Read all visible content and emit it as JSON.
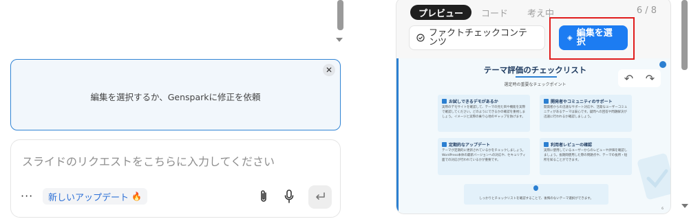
{
  "chat": {
    "edit_hint": "編集を選択するか、Gensparkに修正を依頼",
    "input_placeholder": "スライドのリクエストをこちらに入力してください",
    "more_label": "···",
    "update_chip": "新しいアップデート",
    "close_glyph": "✕"
  },
  "preview": {
    "tabs": [
      "プレビュー",
      "コード",
      "考え中"
    ],
    "page_count": "6 / 8",
    "fact_check_label": "ファクトチェックコンテンツ",
    "select_edit_label": "編集を選択",
    "colors": {
      "accent": "#1c7cf2",
      "highlight_frame": "#e01b1b",
      "slide_accent": "#2b7fd1"
    }
  },
  "slide": {
    "title": "テーマ評価のチェックリスト",
    "subtitle": "選定時の重要なチェックポイント",
    "cards": [
      {
        "title": "お試しできるデモがあるか",
        "body": "実際のデモサイトを確認して、テーマの見た目や機能を実際で確認してください。どのようにできるかの確認を重視しましょう。イメージと実際の乗り心地のギャップを防げます。"
      },
      {
        "title": "開発者やコミュニティのサポート",
        "body": "開発者からの迅速なサポート対応や、活発なユーザーコミュニティがあるテーマは安心です。疑問への回答や問題解決が迅速に行われるか確認しましょう。"
      },
      {
        "title": "定期的なアップデート",
        "body": "テーマが定期的に更新されているかをチェックしましょう。WordPress本体の最新バージョンへの対応や、セキュリティ面での対応が行われているかが重要です。"
      },
      {
        "title": "利用者レビューの確認",
        "body": "実際に使用しているユーザーからのレビューや評価を確認しましょう。長期間使用した際の問題点や、テーマの長所・短所を知ることができます。"
      }
    ],
    "note": "しっかりとチェックリストを確認することで、後悔のないテーマ選択ができます。",
    "slide_number": "6"
  }
}
